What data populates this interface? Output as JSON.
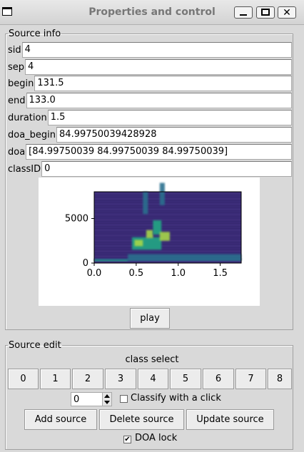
{
  "window": {
    "title": "Properties and control",
    "close_glyph": "✕"
  },
  "source_info": {
    "legend": "Source info",
    "fields": [
      {
        "label": "sid",
        "value": "4"
      },
      {
        "label": "sep",
        "value": "4"
      },
      {
        "label": "begin",
        "value": "131.5"
      },
      {
        "label": "end",
        "value": "133.0"
      },
      {
        "label": "duration",
        "value": "1.5"
      },
      {
        "label": "doa_begin",
        "value": "84.99750039428928"
      },
      {
        "label": "doa",
        "value": "[84.99750039 84.99750039 84.99750039]"
      },
      {
        "label": "classID",
        "value": "0"
      }
    ],
    "play_label": "play"
  },
  "source_edit": {
    "legend": "Source edit",
    "class_select_label": "class select",
    "class_buttons": [
      "0",
      "1",
      "2",
      "3",
      "4",
      "5",
      "6",
      "7",
      "8"
    ],
    "spin_value": "0",
    "classify_label": "Classify with a click",
    "classify_checked": false,
    "add_label": "Add source",
    "delete_label": "Delete source",
    "update_label": "Update source",
    "doa_lock_label": "DOA lock",
    "doa_lock_checked": true
  },
  "chart_data": {
    "type": "heatmap",
    "title": "",
    "xlabel": "",
    "ylabel": "",
    "x_ticks": [
      "0.0",
      "0.5",
      "1.0",
      "1.5"
    ],
    "y_ticks": [
      "0",
      "5000"
    ],
    "xlim": [
      0,
      1.75
    ],
    "ylim": [
      0,
      8000
    ],
    "colormap": "viridis",
    "colors": {
      "background": "#3b2c78",
      "mid": "#2a6f8e",
      "high": "#22a784",
      "peak": "#a7d64a"
    }
  }
}
